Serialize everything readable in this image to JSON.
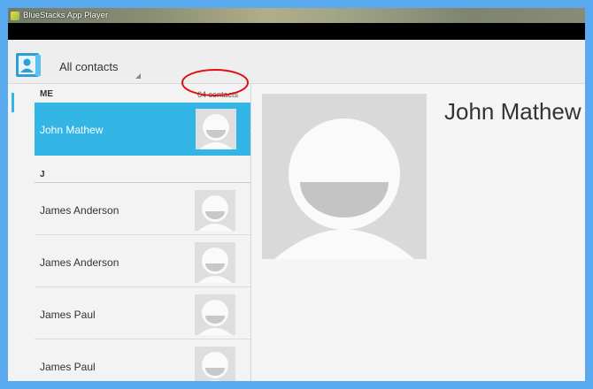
{
  "window": {
    "title": "BlueStacks App Player"
  },
  "actionbar": {
    "app_icon": "contacts-icon",
    "filter_label": "All contacts"
  },
  "list": {
    "me_header": "ME",
    "contact_count": "64 contacts",
    "me_contact": {
      "name": "John Mathew",
      "selected": true
    },
    "section_j": "J",
    "contacts": [
      {
        "name": "James Anderson"
      },
      {
        "name": "James Anderson"
      },
      {
        "name": "James Paul"
      },
      {
        "name": "James Paul"
      }
    ]
  },
  "detail": {
    "name": "John Mathew",
    "photo_icon": "default-avatar-icon"
  },
  "colors": {
    "frame": "#5aaaf0",
    "selected": "#33b5e5",
    "annotation": "#e01010"
  }
}
